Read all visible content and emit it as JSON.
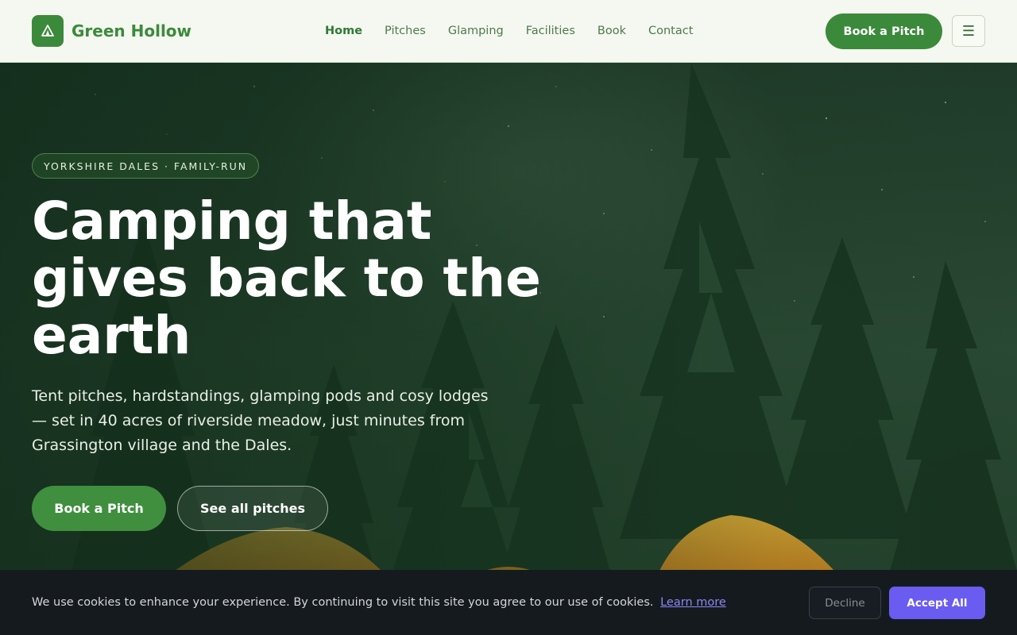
{
  "header": {
    "brand_name": "Green Hollow",
    "logo_icon": "tent-icon",
    "nav": [
      {
        "label": "Home",
        "active": true
      },
      {
        "label": "Pitches"
      },
      {
        "label": "Glamping"
      },
      {
        "label": "Facilities"
      },
      {
        "label": "Book"
      },
      {
        "label": "Contact"
      }
    ],
    "cta_label": "Book a Pitch",
    "menu_icon": "☰"
  },
  "hero": {
    "eyebrow": "YORKSHIRE DALES · FAMILY-RUN",
    "title": "Camping that gives back to the earth",
    "text": "Tent pitches, hardstandings, glamping pods and cosy lodges — set in 40 acres of riverside meadow, just minutes from Grassington village and the Dales.",
    "primary_button": "Book a Pitch",
    "secondary_button": "See all pitches",
    "background": "starry-night-forest-tents-image"
  },
  "cookie_banner": {
    "text": "We use cookies to enhance your experience. By continuing to visit this site you agree to our use of cookies.",
    "link_label": "Learn more",
    "decline_label": "Decline",
    "accept_label": "Accept All"
  },
  "colors": {
    "brand_green": "#3b8a3b",
    "header_bg": "#f5f8f0",
    "cookie_bg": "#151a1f",
    "accept_purple": "#6a5cf0"
  }
}
